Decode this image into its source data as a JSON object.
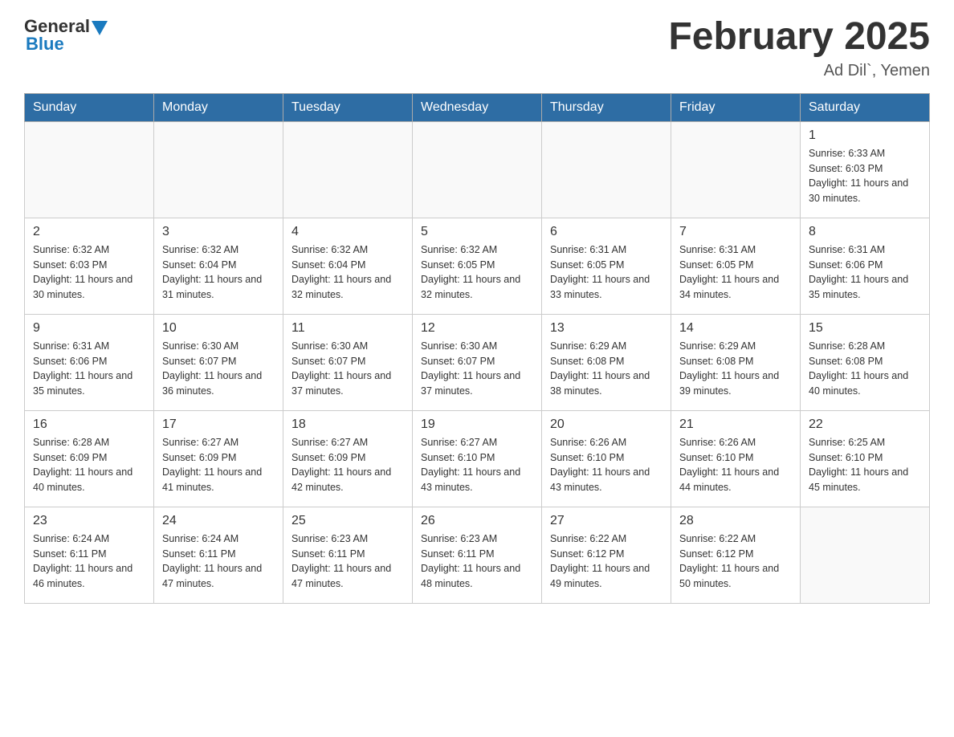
{
  "header": {
    "logo_general": "General",
    "logo_blue": "Blue",
    "month_title": "February 2025",
    "location": "Ad Dil`, Yemen"
  },
  "days_of_week": [
    "Sunday",
    "Monday",
    "Tuesday",
    "Wednesday",
    "Thursday",
    "Friday",
    "Saturday"
  ],
  "weeks": [
    [
      {
        "day": "",
        "info": ""
      },
      {
        "day": "",
        "info": ""
      },
      {
        "day": "",
        "info": ""
      },
      {
        "day": "",
        "info": ""
      },
      {
        "day": "",
        "info": ""
      },
      {
        "day": "",
        "info": ""
      },
      {
        "day": "1",
        "info": "Sunrise: 6:33 AM\nSunset: 6:03 PM\nDaylight: 11 hours and 30 minutes."
      }
    ],
    [
      {
        "day": "2",
        "info": "Sunrise: 6:32 AM\nSunset: 6:03 PM\nDaylight: 11 hours and 30 minutes."
      },
      {
        "day": "3",
        "info": "Sunrise: 6:32 AM\nSunset: 6:04 PM\nDaylight: 11 hours and 31 minutes."
      },
      {
        "day": "4",
        "info": "Sunrise: 6:32 AM\nSunset: 6:04 PM\nDaylight: 11 hours and 32 minutes."
      },
      {
        "day": "5",
        "info": "Sunrise: 6:32 AM\nSunset: 6:05 PM\nDaylight: 11 hours and 32 minutes."
      },
      {
        "day": "6",
        "info": "Sunrise: 6:31 AM\nSunset: 6:05 PM\nDaylight: 11 hours and 33 minutes."
      },
      {
        "day": "7",
        "info": "Sunrise: 6:31 AM\nSunset: 6:05 PM\nDaylight: 11 hours and 34 minutes."
      },
      {
        "day": "8",
        "info": "Sunrise: 6:31 AM\nSunset: 6:06 PM\nDaylight: 11 hours and 35 minutes."
      }
    ],
    [
      {
        "day": "9",
        "info": "Sunrise: 6:31 AM\nSunset: 6:06 PM\nDaylight: 11 hours and 35 minutes."
      },
      {
        "day": "10",
        "info": "Sunrise: 6:30 AM\nSunset: 6:07 PM\nDaylight: 11 hours and 36 minutes."
      },
      {
        "day": "11",
        "info": "Sunrise: 6:30 AM\nSunset: 6:07 PM\nDaylight: 11 hours and 37 minutes."
      },
      {
        "day": "12",
        "info": "Sunrise: 6:30 AM\nSunset: 6:07 PM\nDaylight: 11 hours and 37 minutes."
      },
      {
        "day": "13",
        "info": "Sunrise: 6:29 AM\nSunset: 6:08 PM\nDaylight: 11 hours and 38 minutes."
      },
      {
        "day": "14",
        "info": "Sunrise: 6:29 AM\nSunset: 6:08 PM\nDaylight: 11 hours and 39 minutes."
      },
      {
        "day": "15",
        "info": "Sunrise: 6:28 AM\nSunset: 6:08 PM\nDaylight: 11 hours and 40 minutes."
      }
    ],
    [
      {
        "day": "16",
        "info": "Sunrise: 6:28 AM\nSunset: 6:09 PM\nDaylight: 11 hours and 40 minutes."
      },
      {
        "day": "17",
        "info": "Sunrise: 6:27 AM\nSunset: 6:09 PM\nDaylight: 11 hours and 41 minutes."
      },
      {
        "day": "18",
        "info": "Sunrise: 6:27 AM\nSunset: 6:09 PM\nDaylight: 11 hours and 42 minutes."
      },
      {
        "day": "19",
        "info": "Sunrise: 6:27 AM\nSunset: 6:10 PM\nDaylight: 11 hours and 43 minutes."
      },
      {
        "day": "20",
        "info": "Sunrise: 6:26 AM\nSunset: 6:10 PM\nDaylight: 11 hours and 43 minutes."
      },
      {
        "day": "21",
        "info": "Sunrise: 6:26 AM\nSunset: 6:10 PM\nDaylight: 11 hours and 44 minutes."
      },
      {
        "day": "22",
        "info": "Sunrise: 6:25 AM\nSunset: 6:10 PM\nDaylight: 11 hours and 45 minutes."
      }
    ],
    [
      {
        "day": "23",
        "info": "Sunrise: 6:24 AM\nSunset: 6:11 PM\nDaylight: 11 hours and 46 minutes."
      },
      {
        "day": "24",
        "info": "Sunrise: 6:24 AM\nSunset: 6:11 PM\nDaylight: 11 hours and 47 minutes."
      },
      {
        "day": "25",
        "info": "Sunrise: 6:23 AM\nSunset: 6:11 PM\nDaylight: 11 hours and 47 minutes."
      },
      {
        "day": "26",
        "info": "Sunrise: 6:23 AM\nSunset: 6:11 PM\nDaylight: 11 hours and 48 minutes."
      },
      {
        "day": "27",
        "info": "Sunrise: 6:22 AM\nSunset: 6:12 PM\nDaylight: 11 hours and 49 minutes."
      },
      {
        "day": "28",
        "info": "Sunrise: 6:22 AM\nSunset: 6:12 PM\nDaylight: 11 hours and 50 minutes."
      },
      {
        "day": "",
        "info": ""
      }
    ]
  ]
}
